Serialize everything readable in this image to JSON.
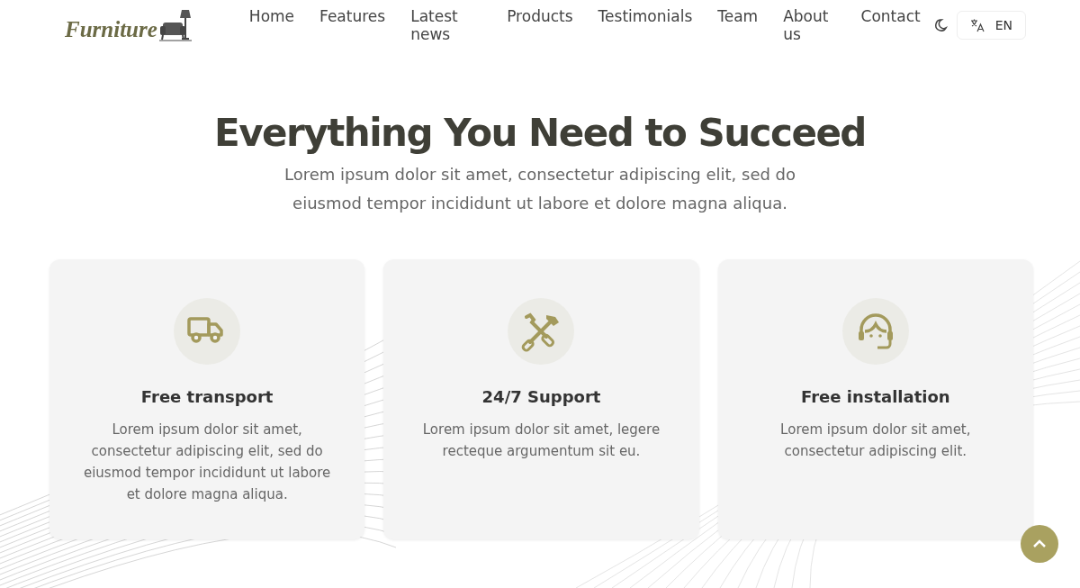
{
  "header": {
    "logo": "Furniture",
    "nav": [
      "Home",
      "Features",
      "Latest news",
      "Products",
      "Testimonials",
      "Team",
      "About us",
      "Contact"
    ],
    "language": "EN"
  },
  "hero": {
    "title": "Everything You Need to Succeed",
    "subtitle": "Lorem ipsum dolor sit amet, consectetur adipiscing elit, sed do eiusmod tempor incididunt ut labore et dolore magna aliqua."
  },
  "features": [
    {
      "kind": "truck",
      "title": "Free transport",
      "text": "Lorem ipsum dolor sit amet, consectetur adipiscing elit, sed do eiusmod tempor incididunt ut labore et dolore magna aliqua."
    },
    {
      "kind": "tools",
      "title": "24/7 Support",
      "text": "Lorem ipsum dolor sit amet, legere recteque argumentum sit eu."
    },
    {
      "kind": "headset",
      "title": "Free installation",
      "text": "Lorem ipsum dolor sit amet, consectetur adipiscing elit."
    }
  ]
}
